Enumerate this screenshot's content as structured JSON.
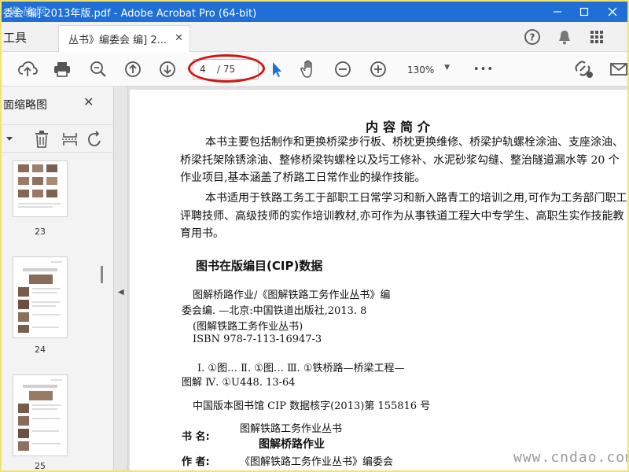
{
  "window": {
    "title": "委会 编] 2013年版.pdf - Adobe Acrobat Pro (64-bit)",
    "watermark_logo": "道赫网",
    "controls": [
      "minimize",
      "maximize",
      "close"
    ]
  },
  "tabs": {
    "tools_label": "工具",
    "document_tab_label": "丛书》编委会 编] 2...",
    "close_glyph": "✕",
    "right_icons": [
      "help-icon",
      "bell-icon",
      "apps-grid-icon"
    ]
  },
  "toolbar": {
    "icons": [
      "upload-icon",
      "print-icon",
      "zoom-search-icon",
      "page-up-icon",
      "page-down-icon",
      "select-cursor-icon",
      "hand-tool-icon",
      "zoom-out-icon",
      "zoom-in-icon",
      "more-icon",
      "share-link-icon",
      "email-icon"
    ],
    "page_current": "4",
    "page_total": "/ 75",
    "zoom_value": "130%",
    "more_glyph": "•••",
    "highlight_color": "#d21414"
  },
  "left_panel": {
    "title": "面缩略图",
    "close_glyph": "✕",
    "tools": [
      "options-dropdown-icon",
      "delete-icon",
      "extract-icon",
      "rotate-icon"
    ],
    "thumbnails": [
      {
        "number": "23"
      },
      {
        "number": "24"
      },
      {
        "number": "25"
      }
    ]
  },
  "document": {
    "section_title": "内容简介",
    "paragraph1": "本书主要包括制作和更换桥梁步行板、桥枕更换维修、桥梁护轨螺栓涂油、支座涂油、桥梁托架除锈涂油、整修桥梁钩螺栓以及圬工修补、水泥砂浆勾缝、整治隧道漏水等 20 个作业项目,基本涵盖了桥路工日常作业的操作技能。",
    "paragraph2": "本书适用于铁路工务工于部职工日常学习和新入路青工的培训之用,可作为工务部门职工评聘技师、高级技师的实作培训教材,亦可作为从事铁道工程大中专学生、高职生实作技能教育用书。",
    "cip_heading": "图书在版编目(CIP)数据",
    "cip_lines": [
      "图解桥路作业/《图解铁路工务作业丛书》编",
      "委会编. —北京:中国铁道出版社,2013. 8",
      "(图解铁路工务作业丛书)",
      "ISBN 978-7-113-16947-3"
    ],
    "class_line1": "Ⅰ. ①图…   Ⅱ. ①图…   Ⅲ. ①铁桥路—桥梁工程—",
    "class_line2": "图解   Ⅳ. ①U448. 13-64",
    "cip_number_line": "中国版本图书馆 CIP 数据核字(2013)第 155816 号",
    "book_label": "书     名:",
    "series_name": "图解铁路工务作业丛书",
    "book_title": "图解桥路作业",
    "author_label": "作     者:",
    "author_value": "《图解铁路工务作业丛书》编委会",
    "watermark": "www.cndao.com"
  },
  "colors": {
    "titlebar": "#1f6fd6",
    "frame": "#f4e36a",
    "select_cursor": "#1f6fd6"
  }
}
